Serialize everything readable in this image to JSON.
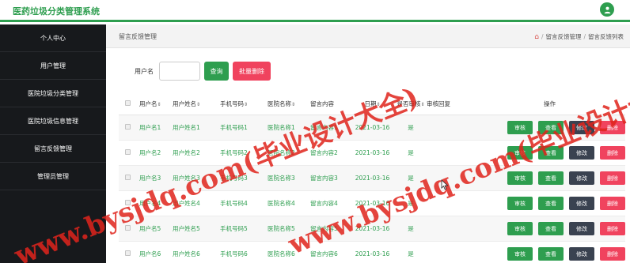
{
  "app": {
    "title": "医药垃圾分类管理系统"
  },
  "sidebar": {
    "items": [
      {
        "label": "个人中心"
      },
      {
        "label": "用户管理"
      },
      {
        "label": "医院垃圾分类管理"
      },
      {
        "label": "医院垃圾信息管理"
      },
      {
        "label": "留言反馈管理"
      },
      {
        "label": "管理员管理"
      }
    ]
  },
  "breadcrumb": {
    "page_title": "留言反馈管理",
    "items": [
      "留言反馈管理",
      "留言反馈列表"
    ]
  },
  "search": {
    "label": "用户名",
    "value": "",
    "query_button": "查询",
    "delete_button": "批量删除"
  },
  "table": {
    "headers": {
      "username": "用户名",
      "name": "用户姓名",
      "phone": "手机号码",
      "hospital": "医院名称",
      "content": "留言内容",
      "date": "日期",
      "audited": "是否审核",
      "reply": "审核回复",
      "actions": "操作"
    },
    "sort_glyph": "⇕",
    "actions": {
      "audit": "审核",
      "view": "查看",
      "edit": "修改",
      "delete": "删除"
    },
    "rows": [
      {
        "username": "用户名1",
        "name": "用户姓名1",
        "phone": "手机号码1",
        "hospital": "医院名称1",
        "content": "留言内容1",
        "date": "2021-03-16",
        "audited": "是",
        "reply": ""
      },
      {
        "username": "用户名2",
        "name": "用户姓名2",
        "phone": "手机号码2",
        "hospital": "医院名称2",
        "content": "留言内容2",
        "date": "2021-03-16",
        "audited": "是",
        "reply": ""
      },
      {
        "username": "用户名3",
        "name": "用户姓名3",
        "phone": "手机号码3",
        "hospital": "医院名称3",
        "content": "留言内容3",
        "date": "2021-03-16",
        "audited": "是",
        "reply": ""
      },
      {
        "username": "用户名4",
        "name": "用户姓名4",
        "phone": "手机号码4",
        "hospital": "医院名称4",
        "content": "留言内容4",
        "date": "2021-03-16",
        "audited": "是",
        "reply": ""
      },
      {
        "username": "用户名5",
        "name": "用户姓名5",
        "phone": "手机号码5",
        "hospital": "医院名称5",
        "content": "留言内容5",
        "date": "2021-03-16",
        "audited": "是",
        "reply": ""
      },
      {
        "username": "用户名6",
        "name": "用户姓名6",
        "phone": "手机号码6",
        "hospital": "医院名称6",
        "content": "留言内容6",
        "date": "2021-03-16",
        "audited": "是",
        "reply": ""
      }
    ]
  },
  "watermark": {
    "text": "www.bysjdq.com(毕业设计大全)"
  },
  "colors": {
    "accent": "#2e9e4f",
    "danger": "#f0435e",
    "dark": "#3a4250",
    "sidebar": "#17191c"
  }
}
